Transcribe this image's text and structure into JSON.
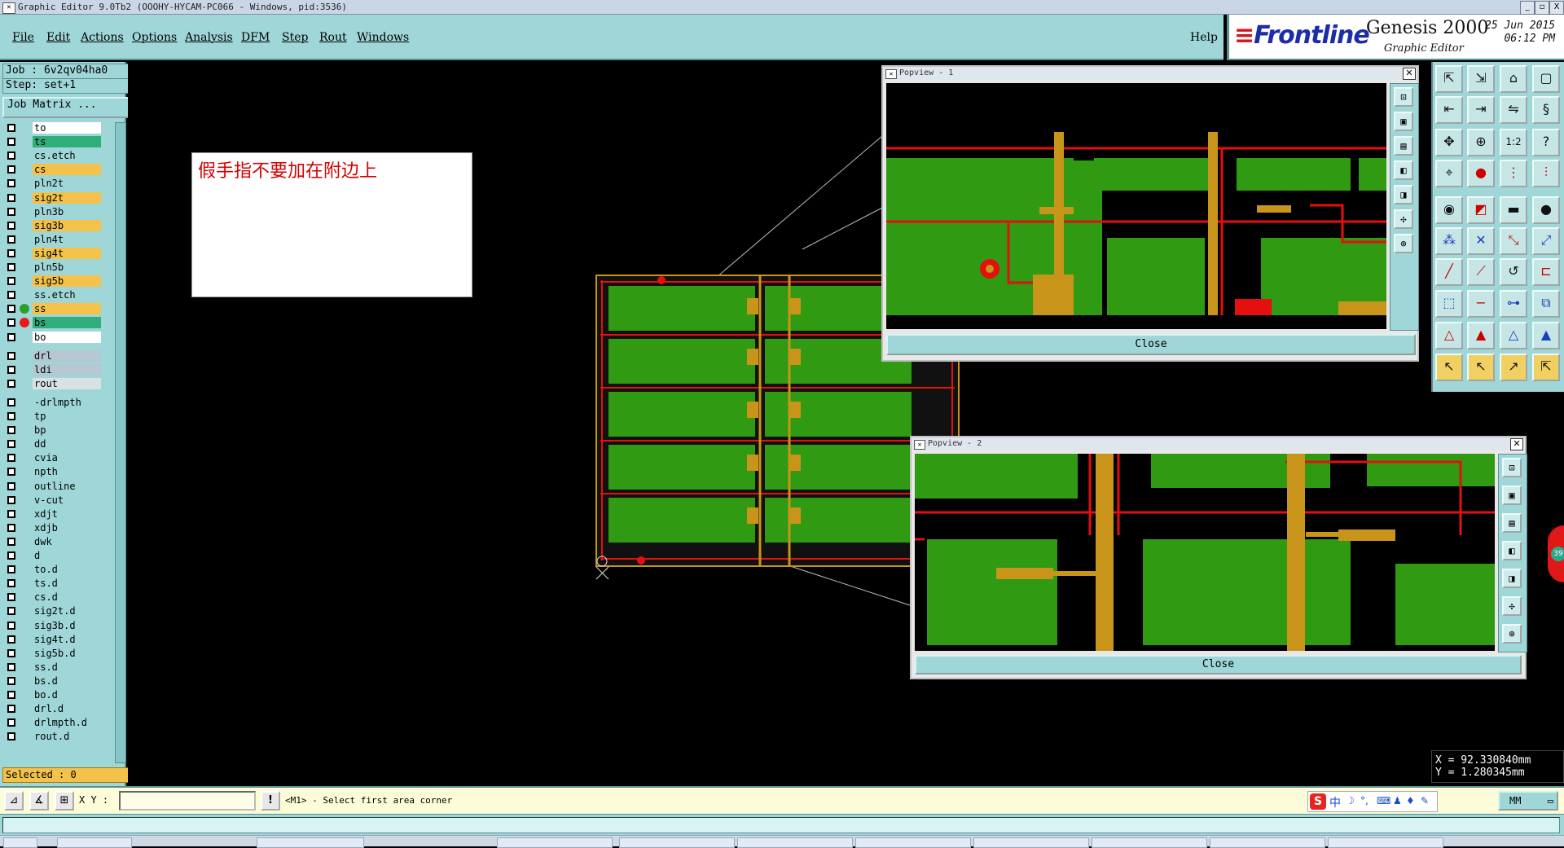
{
  "window": {
    "title": "Graphic Editor 9.0Tb2 (OOOHY-HYCAM-PC066 - Windows, pid:3536)",
    "controls": [
      "_",
      "▫",
      "X"
    ]
  },
  "menu": {
    "items": [
      "File",
      "Edit",
      "Actions",
      "Options",
      "Analysis",
      "DFM",
      "Step",
      "Rout",
      "Windows"
    ],
    "help": "Help"
  },
  "brand": {
    "logo": "Frontline",
    "product": "Genesis 2000",
    "subtitle": "Graphic Editor",
    "date": "25 Jun 2015",
    "time": "06:12 PM"
  },
  "job": {
    "job_line": "Job : 6v2qv04ha0",
    "step_line": "Step: set+1",
    "matrix_button": "Job Matrix ...",
    "selected": "Selected : 0"
  },
  "layers": [
    {
      "name": "to",
      "bg": "#ffffff",
      "dot": ""
    },
    {
      "name": "ts",
      "bg": "#2fae7b",
      "dot": ""
    },
    {
      "name": "cs.etch",
      "bg": "#9fd7d8",
      "dot": ""
    },
    {
      "name": "cs",
      "bg": "#f4c24a",
      "dot": ""
    },
    {
      "name": "pln2t",
      "bg": "#9fd7d8",
      "dot": ""
    },
    {
      "name": "sig2t",
      "bg": "#f4c24a",
      "dot": ""
    },
    {
      "name": "pln3b",
      "bg": "#9fd7d8",
      "dot": ""
    },
    {
      "name": "sig3b",
      "bg": "#f4c24a",
      "dot": ""
    },
    {
      "name": "pln4t",
      "bg": "#9fd7d8",
      "dot": ""
    },
    {
      "name": "sig4t",
      "bg": "#f4c24a",
      "dot": ""
    },
    {
      "name": "pln5b",
      "bg": "#9fd7d8",
      "dot": ""
    },
    {
      "name": "sig5b",
      "bg": "#f4c24a",
      "dot": ""
    },
    {
      "name": "ss.etch",
      "bg": "#9fd7d8",
      "dot": ""
    },
    {
      "name": "ss",
      "bg": "#f4c24a",
      "dot": "#2aa12a"
    },
    {
      "name": "bs",
      "bg": "#2fae7b",
      "dot": "#e51c1c"
    },
    {
      "name": "bo",
      "bg": "#ffffff",
      "dot": ""
    },
    {
      "name": "drl",
      "bg": "#b5c7d0",
      "dot": ""
    },
    {
      "name": "ldi",
      "bg": "#b5c7d0",
      "dot": ""
    },
    {
      "name": "rout",
      "bg": "#d9e2e2",
      "dot": ""
    },
    {
      "name": "-drlmpth",
      "bg": "#9fd7d8",
      "dot": ""
    },
    {
      "name": "tp",
      "bg": "#9fd7d8",
      "dot": ""
    },
    {
      "name": "bp",
      "bg": "#9fd7d8",
      "dot": ""
    },
    {
      "name": "dd",
      "bg": "#9fd7d8",
      "dot": ""
    },
    {
      "name": "cvia",
      "bg": "#9fd7d8",
      "dot": ""
    },
    {
      "name": "npth",
      "bg": "#9fd7d8",
      "dot": ""
    },
    {
      "name": "outline",
      "bg": "#9fd7d8",
      "dot": ""
    },
    {
      "name": "v-cut",
      "bg": "#9fd7d8",
      "dot": ""
    },
    {
      "name": "xdjt",
      "bg": "#9fd7d8",
      "dot": ""
    },
    {
      "name": "xdjb",
      "bg": "#9fd7d8",
      "dot": ""
    },
    {
      "name": "dwk",
      "bg": "#9fd7d8",
      "dot": ""
    },
    {
      "name": "d",
      "bg": "#9fd7d8",
      "dot": ""
    },
    {
      "name": "to.d",
      "bg": "#9fd7d8",
      "dot": ""
    },
    {
      "name": "ts.d",
      "bg": "#9fd7d8",
      "dot": ""
    },
    {
      "name": "cs.d",
      "bg": "#9fd7d8",
      "dot": ""
    },
    {
      "name": "sig2t.d",
      "bg": "#9fd7d8",
      "dot": ""
    },
    {
      "name": "sig3b.d",
      "bg": "#9fd7d8",
      "dot": ""
    },
    {
      "name": "sig4t.d",
      "bg": "#9fd7d8",
      "dot": ""
    },
    {
      "name": "sig5b.d",
      "bg": "#9fd7d8",
      "dot": ""
    },
    {
      "name": "ss.d",
      "bg": "#9fd7d8",
      "dot": ""
    },
    {
      "name": "bs.d",
      "bg": "#9fd7d8",
      "dot": ""
    },
    {
      "name": "bo.d",
      "bg": "#9fd7d8",
      "dot": ""
    },
    {
      "name": "drl.d",
      "bg": "#9fd7d8",
      "dot": ""
    },
    {
      "name": "drlmpth.d",
      "bg": "#9fd7d8",
      "dot": ""
    },
    {
      "name": "rout.d",
      "bg": "#9fd7d8",
      "dot": ""
    }
  ],
  "note": {
    "text": "假手指不要加在附边上"
  },
  "popview1": {
    "title": "Popview - 1",
    "close_label": "Close"
  },
  "popview2": {
    "title": "Popview - 2",
    "close_label": "Close"
  },
  "coords": {
    "x": "X = 92.330840mm",
    "y": "Y = 1.280345mm"
  },
  "side_badge": "39",
  "prompt": {
    "xy_label": "X Y :",
    "xy_value": "",
    "message": "<M1> - Select first area corner",
    "unit": "MM"
  },
  "ime": {
    "logo": "S",
    "lang": "中"
  },
  "colors": {
    "ui_cyan": "#9fd7d8",
    "pcb_green": "#2f9a12",
    "trace_red": "#e40f0f",
    "copper": "#c9941a"
  }
}
